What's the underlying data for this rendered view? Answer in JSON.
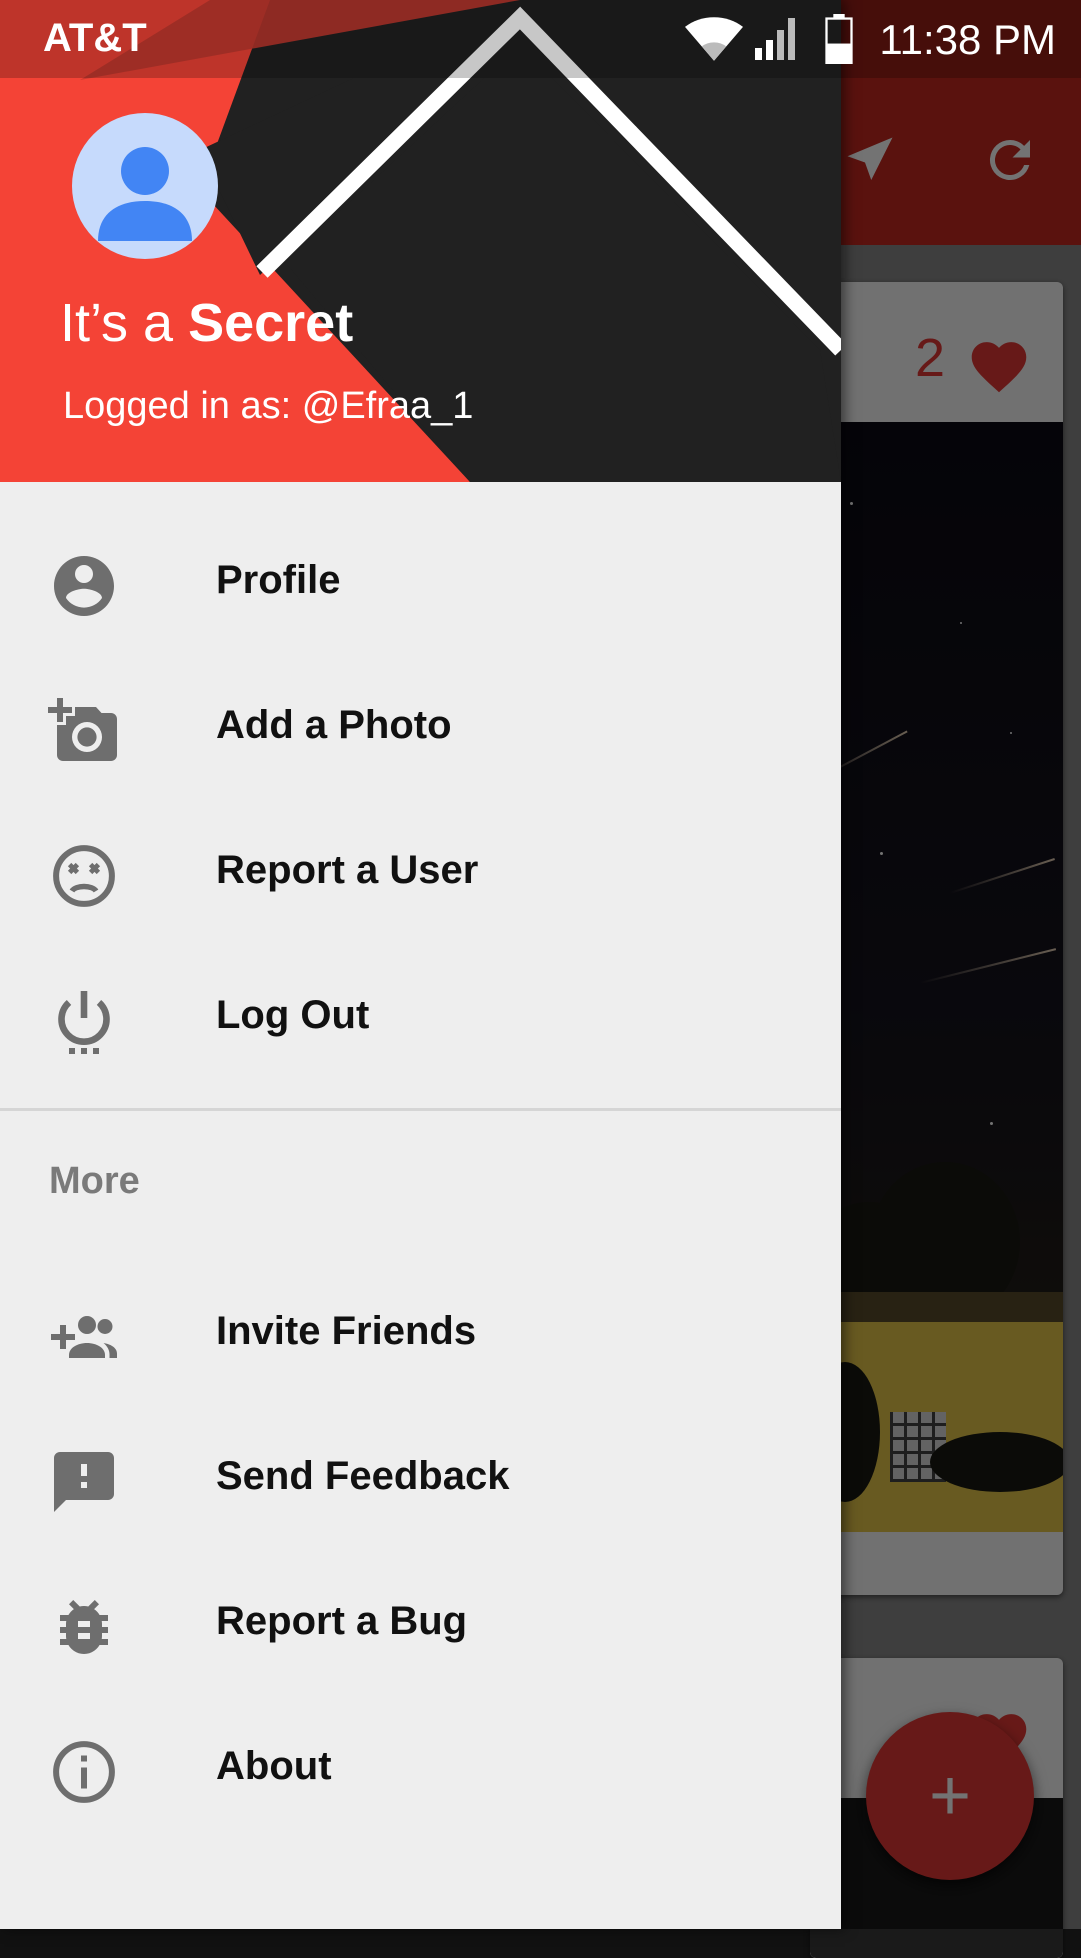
{
  "status_bar": {
    "carrier": "AT&T",
    "time": "11:38 PM",
    "icons": [
      "wifi-icon",
      "cell-signal-icon",
      "battery-icon"
    ]
  },
  "drawer": {
    "header": {
      "title_light": "It’s a ",
      "title_bold": "Secret",
      "logged_in": "Logged in as: @Efraa_1",
      "avatar_icon": "account-avatar-icon"
    },
    "menu": [
      {
        "label": "Profile",
        "icon": "account-circle-icon"
      },
      {
        "label": "Add a Photo",
        "icon": "add-photo-icon"
      },
      {
        "label": "Report a User",
        "icon": "dizzy-face-icon"
      },
      {
        "label": "Log Out",
        "icon": "power-icon"
      }
    ],
    "more_section": {
      "title": "More",
      "items": [
        {
          "label": "Invite Friends",
          "icon": "add-group-icon"
        },
        {
          "label": "Send Feedback",
          "icon": "feedback-icon"
        },
        {
          "label": "Report a Bug",
          "icon": "bug-icon"
        },
        {
          "label": "About",
          "icon": "info-icon"
        }
      ]
    }
  },
  "background_feed": {
    "toolbar_icons": [
      "send-location-icon",
      "refresh-icon"
    ],
    "card": {
      "like_count": "2",
      "icon": "heart-icon"
    },
    "fab": {
      "label": "+",
      "icon": "add-icon"
    }
  },
  "colors": {
    "accent_red": "#f44336",
    "toolbar_red": "#c7281f",
    "header_dark": "#212121",
    "drawer_bg": "#eeeeee",
    "icon_gray": "#6e6e6e",
    "heart_red": "#e53935"
  }
}
